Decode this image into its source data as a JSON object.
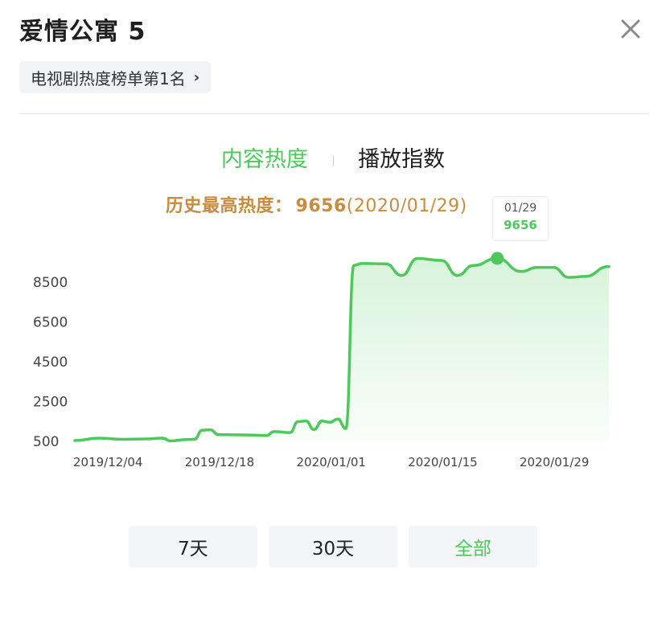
{
  "header": {
    "title": "爱情公寓 5",
    "rank_chip": "电视剧热度榜单第1名"
  },
  "tabs": [
    {
      "label": "内容热度",
      "active": true
    },
    {
      "label": "播放指数",
      "active": false
    }
  ],
  "peak": {
    "label": "历史最高热度：",
    "value": "9656",
    "date": "(2020/01/29)"
  },
  "tooltip": {
    "date": "01/29",
    "value": "9656"
  },
  "range_buttons": [
    {
      "label": "7天",
      "active": false
    },
    {
      "label": "30天",
      "active": false
    },
    {
      "label": "全部",
      "active": true
    }
  ],
  "colors": {
    "accent": "#4cc95a",
    "peak_text": "#c98b3d"
  },
  "chart_data": {
    "type": "area",
    "x_ticks": [
      "2019/12/04",
      "2019/12/18",
      "2020/01/01",
      "2020/01/15",
      "2020/01/29"
    ],
    "y_ticks": [
      500,
      2500,
      4500,
      6500,
      8500
    ],
    "ylim": [
      500,
      10300
    ],
    "highlight": {
      "date": "2020/01/29",
      "value": 9656
    },
    "series": [
      {
        "points": [
          [
            "2019/12/04",
            500
          ],
          [
            "2019/12/07",
            620
          ],
          [
            "2019/12/10",
            560
          ],
          [
            "2019/12/13",
            580
          ],
          [
            "2019/12/15",
            620
          ],
          [
            "2019/12/16",
            480
          ],
          [
            "2019/12/18",
            550
          ],
          [
            "2019/12/19",
            560
          ],
          [
            "2019/12/20",
            1020
          ],
          [
            "2019/12/21",
            1040
          ],
          [
            "2019/12/22",
            800
          ],
          [
            "2019/12/26",
            780
          ],
          [
            "2019/12/28",
            750
          ],
          [
            "2019/12/29",
            950
          ],
          [
            "2019/12/31",
            900
          ],
          [
            "2020/01/01",
            1450
          ],
          [
            "2020/01/02",
            1480
          ],
          [
            "2020/01/03",
            1050
          ],
          [
            "2020/01/04",
            1480
          ],
          [
            "2020/01/05",
            1420
          ],
          [
            "2020/01/06",
            1580
          ],
          [
            "2020/01/07",
            1100
          ],
          [
            "2020/01/08",
            9300
          ],
          [
            "2020/01/09",
            9400
          ],
          [
            "2020/01/12",
            9380
          ],
          [
            "2020/01/14",
            8800
          ],
          [
            "2020/01/16",
            9650
          ],
          [
            "2020/01/19",
            9550
          ],
          [
            "2020/01/21",
            8800
          ],
          [
            "2020/01/23",
            9300
          ],
          [
            "2020/01/26",
            9656
          ],
          [
            "2020/01/29",
            9000
          ],
          [
            "2020/01/31",
            9200
          ],
          [
            "2020/02/02",
            9200
          ],
          [
            "2020/02/04",
            8700
          ],
          [
            "2020/02/06",
            8750
          ],
          [
            "2020/02/09",
            9250
          ]
        ]
      }
    ]
  }
}
